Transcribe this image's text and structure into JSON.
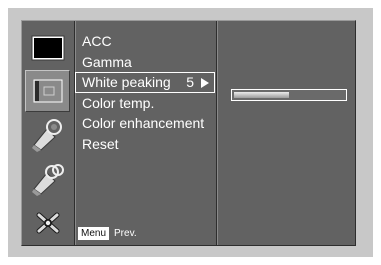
{
  "sidebar": {
    "icons": [
      {
        "name": "screen-icon",
        "selected": false
      },
      {
        "name": "picture-icon",
        "selected": true
      },
      {
        "name": "audio-icon",
        "selected": false
      },
      {
        "name": "time-icon",
        "selected": false
      },
      {
        "name": "special-icon",
        "selected": false
      }
    ]
  },
  "menu": {
    "items": [
      {
        "label": "ACC"
      },
      {
        "label": "Gamma"
      },
      {
        "label": "White peaking",
        "value": "5",
        "selected": true
      },
      {
        "label": "Color temp."
      },
      {
        "label": "Color enhancement"
      },
      {
        "label": "Reset"
      }
    ]
  },
  "white_peaking_slider": {
    "level_fraction": 0.5
  },
  "footer": {
    "menu_key": "Menu",
    "prev_label": "Prev."
  },
  "colors": {
    "panel_bg": "#626262",
    "frame_bg": "#c8c8c8",
    "text": "#ffffff",
    "highlight": "#ffffff"
  }
}
